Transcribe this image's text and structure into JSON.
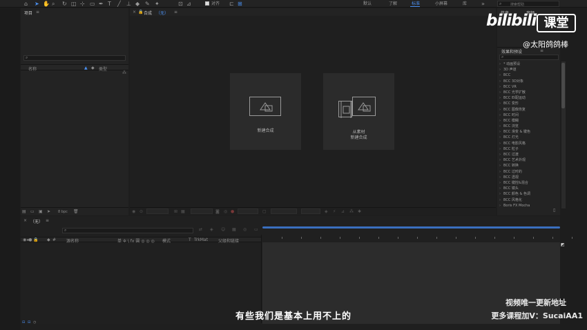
{
  "toolbar": {
    "home": "⌂",
    "snap_label": "对齐",
    "workspaces": [
      "默认",
      "了解",
      "标准",
      "小屏幕",
      "库"
    ],
    "active_workspace": "标准",
    "search_placeholder": "搜索帮助",
    "more": "»"
  },
  "project_panel": {
    "title": "项目",
    "menu": "≡",
    "columns": {
      "name": "名称",
      "type": "类型"
    },
    "bpc": "8 bpc"
  },
  "comp_panel": {
    "title": "合成",
    "comp_name": "（无）",
    "menu": "≡",
    "new_comp_label": "新建合成",
    "from_footage_line1": "从素材",
    "from_footage_line2": "新建合成"
  },
  "right_panel": {
    "tab_info": "信息",
    "tab_audio": "音频",
    "effects_title": "效果和预设",
    "menu": "≡",
    "effects": [
      "* 动画预设",
      "3D 声道",
      "BCC",
      "BCC 3D对象",
      "BCC VR",
      "BCC 光学扩散",
      "BCC 匹配运动",
      "BCC 变形",
      "BCC 图像恢复",
      "BCC 时间",
      "BCC 模糊",
      "BCC 浏览",
      "BCC 滑变 & 键色",
      "BCC 灯光",
      "BCC 电影风格",
      "BCC 粒子",
      "BCC 过渡",
      "BCC 艺术外观",
      "BCC 转换",
      "BCC 过时的",
      "BCC 透视",
      "BCC 键控&混合",
      "BCC 镜头",
      "BCC 颜色 & 色调",
      "BCC 风格化",
      "Boris FX Mocha"
    ]
  },
  "timeline": {
    "tab_label": "（无）",
    "menu": "≡",
    "columns": {
      "source_name": "源名称",
      "switches": "单 ✲ \\ fx 圓 ◎ ◎ ◎",
      "mode": "模式",
      "t": "T",
      "trkmat": "TrkMat",
      "parent": "父级和链接"
    }
  },
  "overlay": {
    "subtitle": "有些我们是基本上用不上的",
    "watermark_line1": "视频唯一更新地址",
    "watermark_line2": "更多课程加V：SucaiAA1",
    "logo": "bilibili",
    "badge": "课堂",
    "uploader": "@太阳鸽鸽棒"
  },
  "colors": {
    "background": "#1d1d1d",
    "panel": "#232323",
    "accent": "#4a8ff0",
    "timeline_bar": "#3a6fbf",
    "card": "#2b2b2b"
  }
}
